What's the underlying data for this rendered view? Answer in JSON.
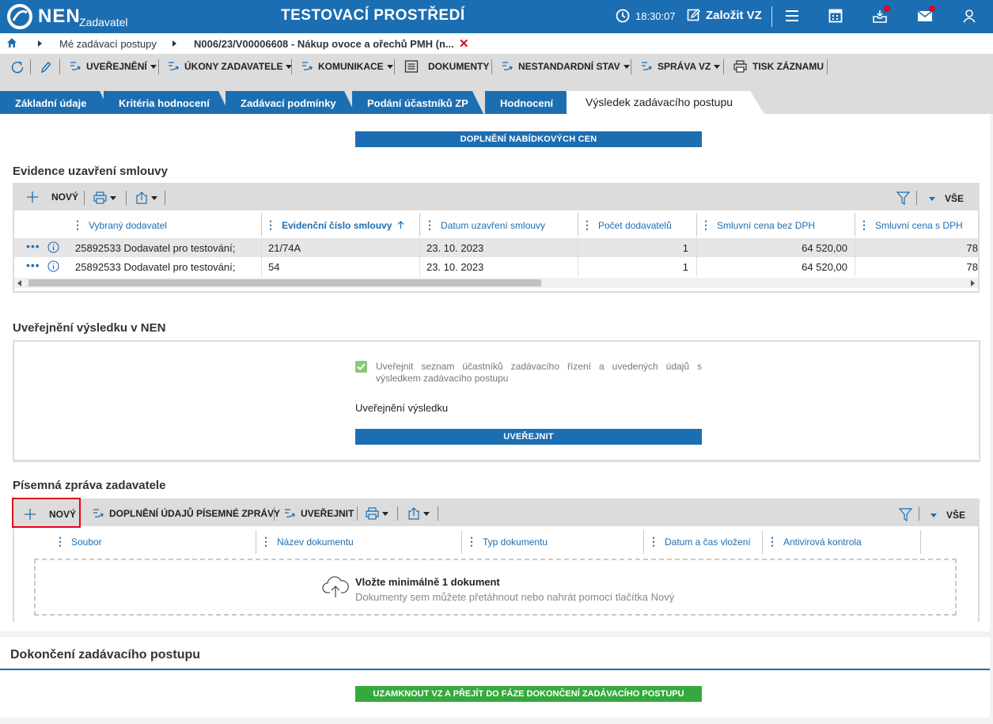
{
  "header": {
    "logo": "NEN",
    "logo_sub": "Zadavatel",
    "env_title": "TESTOVACÍ PROSTŘEDÍ",
    "time": "18:30:07",
    "create_label": "Založit VZ"
  },
  "breadcrumb": {
    "items": [
      "Mé zadávací postupy",
      "N006/23/V00006608 - Nákup ovoce a ořechů PMH (n..."
    ]
  },
  "toolbar": {
    "uverejneni": "UVEŘEJNĚNÍ",
    "ukony": "ÚKONY ZADAVATELE",
    "komunikace": "KOMUNIKACE",
    "dokumenty": "DOKUMENTY",
    "nestandardni": "NESTANDARDNÍ STAV",
    "sprava": "SPRÁVA VZ",
    "tisk": "TISK ZÁZNAMU"
  },
  "tabs": [
    "Základní údaje",
    "Kritéria hodnocení",
    "Zadávací podmínky",
    "Podání účastníků ZP",
    "Hodnocení",
    "Výsledek zadávacího postupu"
  ],
  "doplneni_btn": "DOPLNĚNÍ NABÍDKOVÝCH CEN",
  "evidence": {
    "title": "Evidence uzavření smlouvy",
    "new_label": "NOVÝ",
    "all_label": "VŠE",
    "columns": [
      "Vybraný dodavatel",
      "Evidenční číslo smlouvy",
      "Datum uzavření smlouvy",
      "Počet dodavatelů",
      "Smluvní cena bez DPH",
      "Smluvní cena s DPH"
    ],
    "rows": [
      {
        "dodavatel": "25892533 Dodavatel pro testování;",
        "cislo": "21/74A",
        "datum": "23. 10. 2023",
        "pocet": "1",
        "bez_dph": "64 520,00",
        "s_dph": "78"
      },
      {
        "dodavatel": "25892533 Dodavatel pro testování;",
        "cislo": "54",
        "datum": "23. 10. 2023",
        "pocet": "1",
        "bez_dph": "64 520,00",
        "s_dph": "78"
      }
    ]
  },
  "uverejneni": {
    "title": "Uveřejnění výsledku v NEN",
    "checkbox_label": "Uveřejnit seznam účastníků zadávacího řízení a uvedených údajů s výsledkem zadávacího postupu",
    "checked": true,
    "subheading": "Uveřejnění výsledku",
    "button": "UVEŘEJNIT"
  },
  "pisemna": {
    "title": "Písemná zpráva zadavatele",
    "new_label": "NOVÝ",
    "doplneni_label": "DOPLNĚNÍ ÚDAJŮ PÍSEMNÉ ZPRÁVY",
    "uverejnit_label": "UVEŘEJNIT",
    "all_label": "VŠE",
    "columns": [
      "Soubor",
      "Název dokumentu",
      "Typ dokumentu",
      "Datum a čas vložení",
      "Antivirová kontrola"
    ],
    "drop_title": "Vložte minimálně 1 dokument",
    "drop_hint": "Dokumenty sem můžete přetáhnout nebo nahrát pomocí tlačítka Nový"
  },
  "dokonceni": {
    "title": "Dokončení zadávacího postupu",
    "button": "UZAMKNOUT VZ A PŘEJÍT DO FÁZE DOKONČENÍ ZADÁVACÍHO POSTUPU"
  },
  "colors": {
    "primary": "#1c6eb2",
    "success": "#35a93d",
    "alert": "#e3001b"
  },
  "icons": [
    "logo-icon",
    "clock-icon",
    "edit-icon",
    "menu-icon",
    "calculator-icon",
    "inbox-icon",
    "mail-icon",
    "user-icon",
    "home-icon",
    "refresh-icon",
    "pencil-icon",
    "action-icon",
    "document-icon",
    "print-icon",
    "plus-icon",
    "export-icon",
    "filter-icon",
    "info-icon",
    "cloud-upload-icon"
  ]
}
